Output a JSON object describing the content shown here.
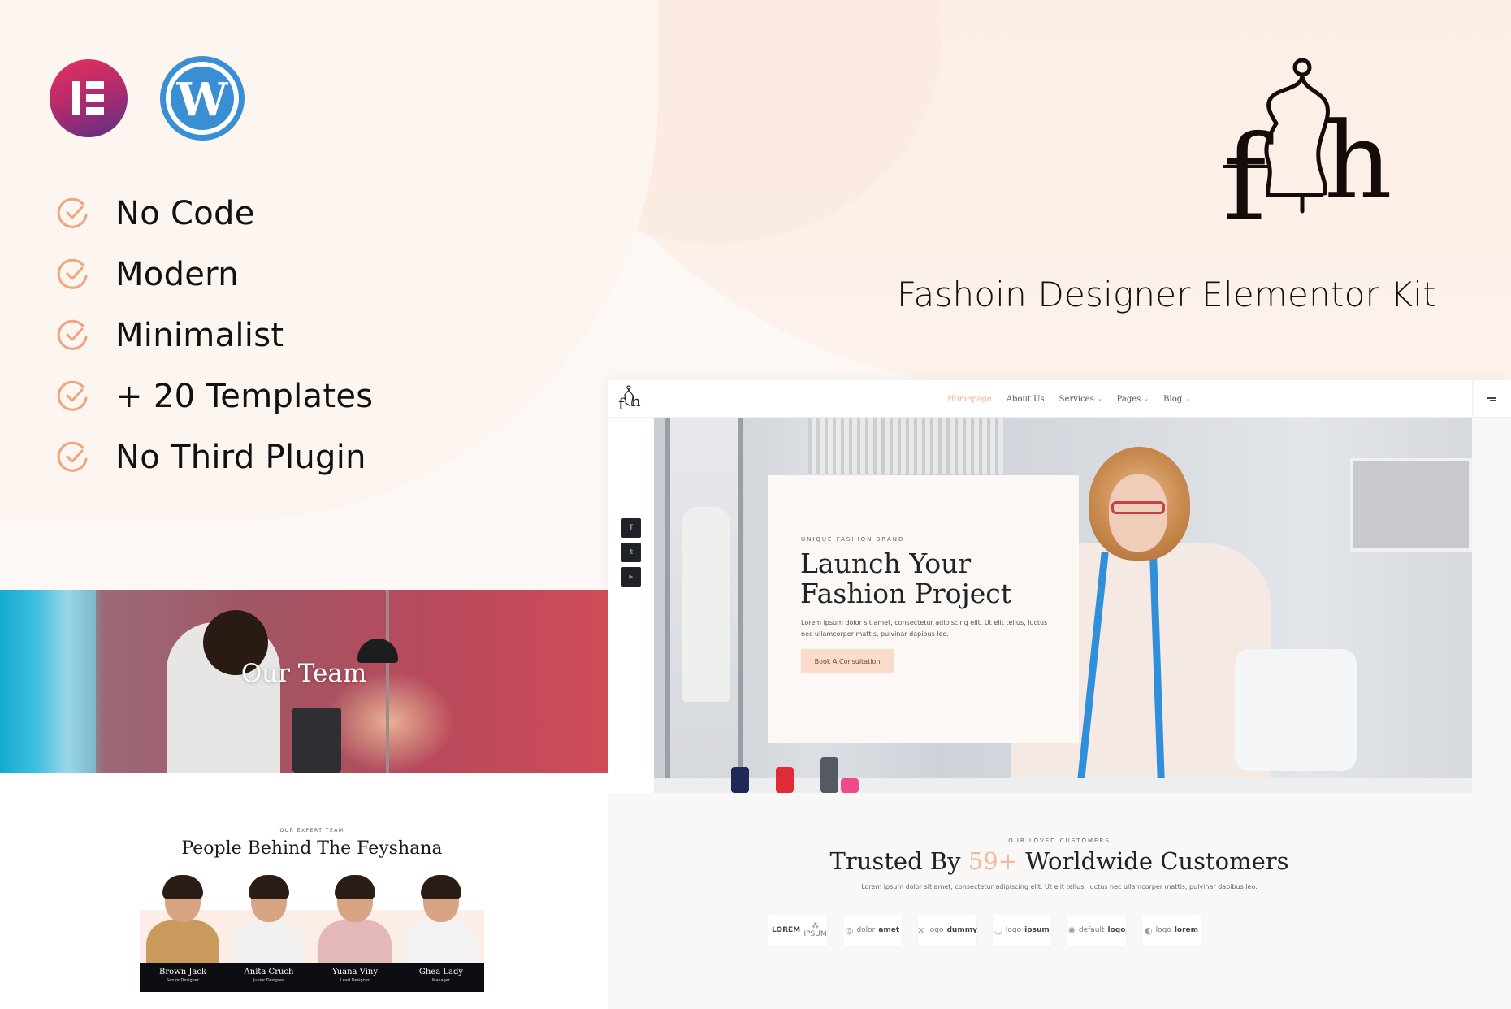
{
  "brand_logos": [
    {
      "name": "Elementor",
      "icon": "elementor-logo"
    },
    {
      "name": "WordPress",
      "icon": "wordpress-logo",
      "glyph": "W"
    }
  ],
  "features": [
    {
      "label": "No Code",
      "icon": "check-circle-icon"
    },
    {
      "label": "Modern",
      "icon": "check-circle-icon"
    },
    {
      "label": "Minimalist",
      "icon": "check-circle-icon"
    },
    {
      "label": "+ 20 Templates",
      "icon": "check-circle-icon"
    },
    {
      "label": "No Third Plugin",
      "icon": "check-circle-icon"
    }
  ],
  "kit": {
    "logo_text": "fh",
    "subtitle": "Fashoin Designer Elementor Kit"
  },
  "colors": {
    "accent": "#f0a57e",
    "highlight": "#f6b79b",
    "button_bg": "#fbdccb",
    "dark": "#0c0e12",
    "elementor": "#d63362",
    "wordpress": "#3a8ed4"
  },
  "site_preview": {
    "nav": {
      "items": [
        {
          "label": "Homepage",
          "active": true,
          "has_caret": false
        },
        {
          "label": "About Us",
          "active": false,
          "has_caret": false
        },
        {
          "label": "Services",
          "active": false,
          "has_caret": true
        },
        {
          "label": "Pages",
          "active": false,
          "has_caret": true
        },
        {
          "label": "Blog",
          "active": false,
          "has_caret": true
        }
      ],
      "caret": "⌄",
      "menu_icon": "hamburger-menu-icon"
    },
    "social": [
      {
        "icon": "facebook-icon",
        "glyph": "f"
      },
      {
        "icon": "twitter-icon",
        "glyph": "t"
      },
      {
        "icon": "youtube-icon",
        "glyph": "▶"
      }
    ],
    "hero": {
      "eyebrow": "UNIQUE FASHION BRAND",
      "title_line1": "Launch Your",
      "title_line2": "Fashion Project",
      "text": "Lorem ipsum dolor sit amet, consectetur adipiscing elit. Ut elit tellus, luctus nec ullamcorper mattis, pulvinar dapibus leo.",
      "button": "Book A Consultation"
    },
    "customers": {
      "eyebrow": "OUR LOVED CUSTOMERS",
      "title_before": "Trusted By",
      "title_highlight": "59+",
      "title_after": "Worldwide Customers",
      "text": "Lorem ipsum dolor sit amet, consectetur adipiscing elit. Ut elit tellus, luctus nec ullamcorper mattis, pulvinar dapibus leo.",
      "logos": [
        {
          "icon": "lorem-ipsum-icon",
          "glyph": "",
          "light": "",
          "bold": "LOREM",
          "suffix": "⁂ IPSUM"
        },
        {
          "icon": "dolor-amet-icon",
          "glyph": "◎",
          "light": "dolor",
          "bold": "amet",
          "suffix": ""
        },
        {
          "icon": "logo-dummy-icon",
          "glyph": "✕",
          "light": "logo",
          "bold": "dummy",
          "suffix": ""
        },
        {
          "icon": "logo-ipsum-icon",
          "glyph": "◡",
          "light": "logo",
          "bold": "ipsum",
          "suffix": ""
        },
        {
          "icon": "default-logo-icon",
          "glyph": "✺",
          "light": "default",
          "bold": "logo",
          "suffix": ""
        },
        {
          "icon": "logo-lorem-icon",
          "glyph": "◐",
          "light": "logo",
          "bold": "lorem",
          "suffix": ""
        }
      ]
    }
  },
  "team_banner": {
    "title": "Our Team"
  },
  "team_section": {
    "eyebrow": "OUR EXPERT TEAM",
    "title": "People Behind The Feyshana",
    "members": [
      {
        "name": "Brown Jack",
        "role": "Senior Designer",
        "shirt": "#c99a5c"
      },
      {
        "name": "Anita Cruch",
        "role": "Junior Designer",
        "shirt": "#f3f1f0"
      },
      {
        "name": "Yuana Viny",
        "role": "Lead Designer",
        "shirt": "#e4b8b8"
      },
      {
        "name": "Ghea Lady",
        "role": "Manager",
        "shirt": "#f2f2f2"
      }
    ]
  }
}
